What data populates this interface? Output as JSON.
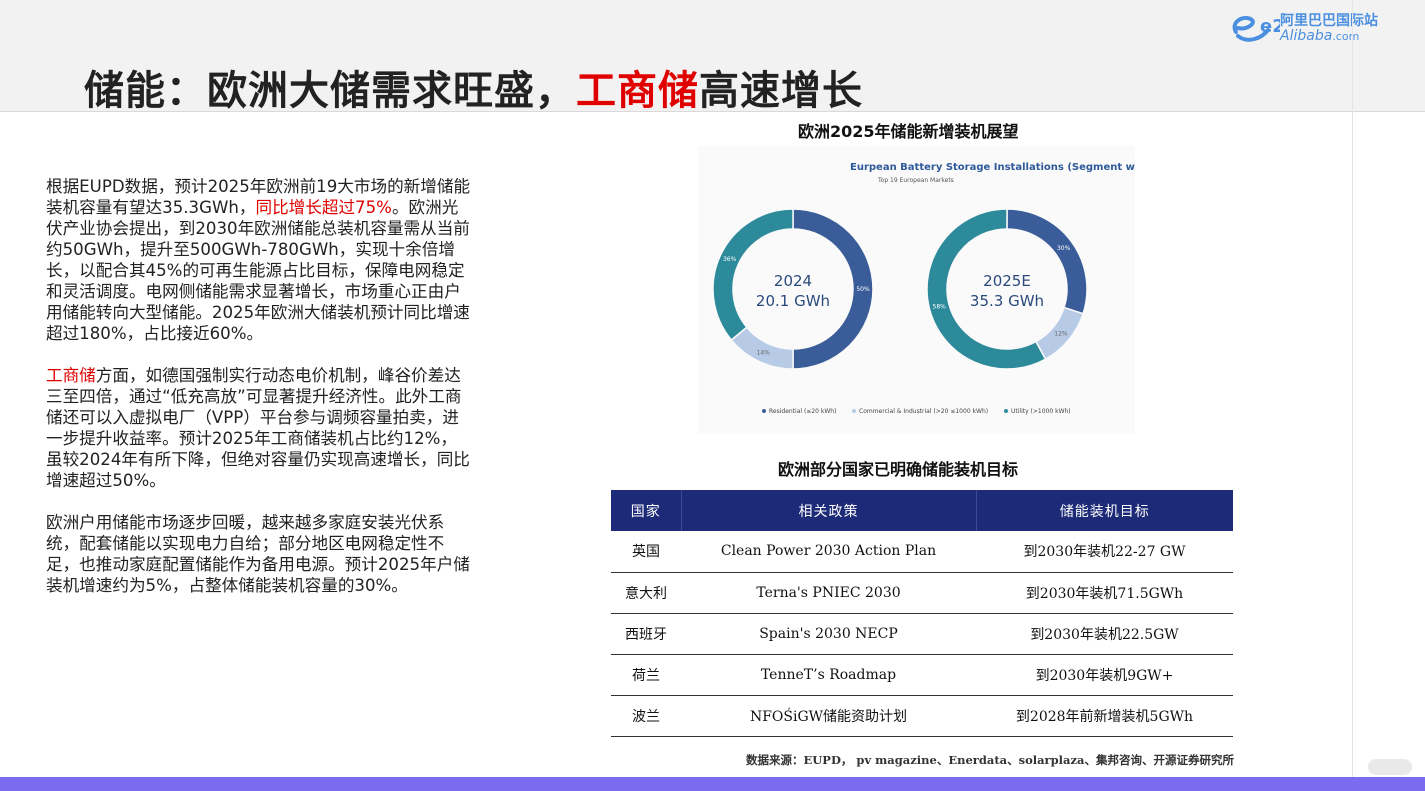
{
  "header": {
    "title_part1": "储能：欧洲大储需求旺盛，",
    "title_highlight": "工商储",
    "title_part2": "高速增长"
  },
  "logo": {
    "cn": "阿里巴巴国际站",
    "en": "Alibaba",
    "en_suffix": ".com",
    "mark": "e2"
  },
  "body": {
    "p1_a": "根据EUPD数据，预计2025年欧洲前19大市场的新增储能装机容量有望达35.3GWh，",
    "p1_red": "同比增长超过75%",
    "p1_b": "。欧洲光伏产业协会提出，到2030年欧洲储能总装机容量需从当前约50GWh，提升至500GWh-780GWh，实现十余倍增长，以配合其45%的可再生能源占比目标，保障电网稳定和灵活调度。电网侧储能需求显著增长，市场重心正由户用储能转向大型储能。2025年欧洲大储装机预计同比增速超过180%，占比接近60%。",
    "p2_red": "工商储",
    "p2_b": "方面，如德国强制实行动态电价机制，峰谷价差达三至四倍，通过“低充高放”可显著提升经济性。此外工商储还可以入虚拟电厂（VPP）平台参与调频容量拍卖，进一步提升收益率。预计2025年工商储装机占比约12%，虽较2024年有所下降，但绝对容量仍实现高速增长，同比增速超过50%。",
    "p3": "欧洲户用储能市场逐步回暖，越来越多家庭安装光伏系统，配套储能以实现电力自给；部分地区电网稳定性不足，也推动家庭配置储能作为备用电源。预计2025年户储装机增速约为5%，占整体储能装机容量的30%。"
  },
  "chart_section_title": "欧洲2025年储能新增装机展望",
  "chart_data": {
    "type": "pie",
    "title": "Eurpean Battery Storage Installations (Segment wise)",
    "subtitle": "Top 19 European Markets",
    "legend_position": "bottom",
    "legend": [
      "Residential (≤20 kWh)",
      "Commercial & Industrial (>20 ≤1000 kWh)",
      "Utility (>1000 kWh)"
    ],
    "colors": [
      "#3a5d9a",
      "#b7cbe6",
      "#2d8a9b"
    ],
    "charts": [
      {
        "center_year": "2024",
        "center_value": "20.1 GWh",
        "values": [
          50,
          14,
          36
        ],
        "labels": [
          "50%",
          "14%",
          "36%"
        ]
      },
      {
        "center_year": "2025E",
        "center_value": "35.3 GWh",
        "values": [
          30,
          12,
          58
        ],
        "labels": [
          "30%",
          "12%",
          "58%"
        ]
      }
    ]
  },
  "table_title": "欧洲部分国家已明确储能装机目标",
  "table": {
    "headers": [
      "国家",
      "相关政策",
      "储能装机目标"
    ],
    "rows": [
      [
        "英国",
        "Clean Power 2030 Action Plan",
        "到2030年装机22-27 GW"
      ],
      [
        "意大利",
        "Terna's PNIEC 2030",
        "到2030年装机71.5GWh"
      ],
      [
        "西班牙",
        "Spain's 2030 NECP",
        "到2030年装机22.5GW"
      ],
      [
        "荷兰",
        "TenneT’s Roadmap",
        "到2030年装机9GW+"
      ],
      [
        "波兰",
        "NFOŚiGW储能资助计划",
        "到2028年前新增装机5GWh"
      ]
    ]
  },
  "source": "数据来源：EUPD， pv magazine、Enerdata、solarplaza、集邦咨询、开源证券研究所"
}
